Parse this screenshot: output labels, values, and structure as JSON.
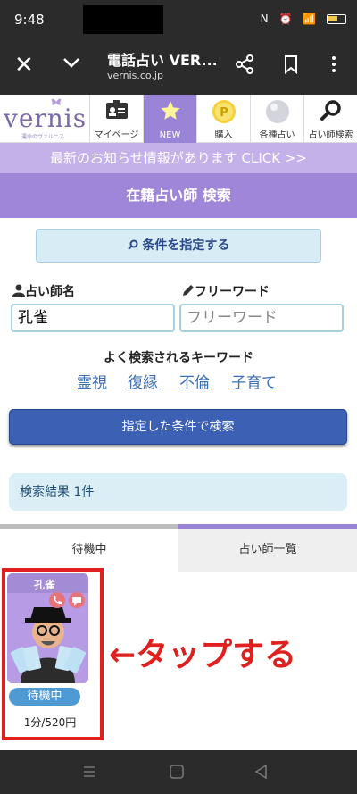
{
  "status": {
    "time": "9:48",
    "icons": "N ⏰ ✉ ᯤ ▮▮"
  },
  "browser": {
    "title": "電話占い VER...",
    "url": "vernis.co.jp"
  },
  "site": {
    "logo_text": "vernis",
    "logo_tagline": "運命のヴェルニス",
    "nav": [
      {
        "label": "マイページ",
        "icon": "id-card-icon"
      },
      {
        "label": "NEW",
        "icon": "star-icon"
      },
      {
        "label": "購入",
        "icon": "coin-icon"
      },
      {
        "label": "各種占い",
        "icon": "crystal-ball-icon"
      },
      {
        "label": "占い師検索",
        "icon": "search-icon"
      }
    ],
    "news": "最新のお知らせ情報があります CLICK >>",
    "section_title": "在籍占い師 検索"
  },
  "search": {
    "condition_button": "条件を指定する",
    "name_label": "占い師名",
    "name_value": "孔雀",
    "free_label": "フリーワード",
    "free_placeholder": "フリーワード",
    "keywords_title": "よく検索されるキーワード",
    "keywords": [
      "霊視",
      "復縁",
      "不倫",
      "子育て"
    ],
    "submit_button": "指定した条件で検索",
    "result_text": "検索結果 1件"
  },
  "tabs": {
    "left": "待機中",
    "right": "占い師一覧"
  },
  "card": {
    "name": "孔雀",
    "status": "待機中",
    "price": "1分/520円"
  },
  "annotation": "←タップする",
  "colors": {
    "accent": "#9a84d6",
    "highlight": "#e0201e",
    "primary_button": "#3c60b3"
  }
}
